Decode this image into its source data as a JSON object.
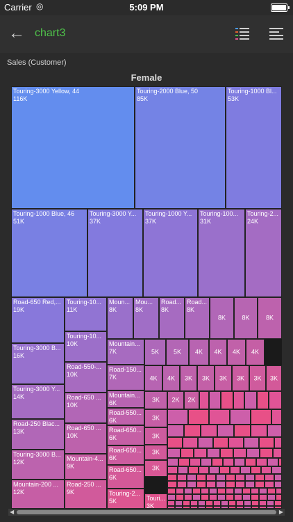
{
  "status": {
    "carrier": "Carrier",
    "time": "5:09 PM"
  },
  "nav": {
    "title": "chart3"
  },
  "header": {
    "subtitle": "Sales (Customer)"
  },
  "colors": {
    "accent": "#4fc24a",
    "blue": "#4b9bfa",
    "pink": "#e0548e"
  },
  "chart_data": {
    "type": "treemap",
    "title": "Female",
    "subtitle": "Sales (Customer)",
    "cells": [
      {
        "name": "Touring-3000 Yellow, 44",
        "value": "116K"
      },
      {
        "name": "Touring-2000 Blue, 50",
        "value": "85K"
      },
      {
        "name": "Touring-1000 Bl...",
        "value": "53K"
      },
      {
        "name": "Touring-1000 Blue, 46",
        "value": "51K"
      },
      {
        "name": "Touring-3000 Y...",
        "value": "37K"
      },
      {
        "name": "Touring-1000 Y...",
        "value": "37K"
      },
      {
        "name": "Touring-100...",
        "value": "31K"
      },
      {
        "name": "Touring-2...",
        "value": "24K"
      },
      {
        "name": "Road-650 Red,...",
        "value": "19K"
      },
      {
        "name": "Touring-10...",
        "value": "11K"
      },
      {
        "name": "Moun...",
        "value": "8K"
      },
      {
        "name": "Mou...",
        "value": "8K"
      },
      {
        "name": "Road...",
        "value": "8K"
      },
      {
        "name": "Road...",
        "value": "8K"
      },
      {
        "name": "",
        "value": "8K"
      },
      {
        "name": "",
        "value": "8K"
      },
      {
        "name": "",
        "value": "8K"
      },
      {
        "name": "Touring-3000 B...",
        "value": "16K"
      },
      {
        "name": "Touring-10...",
        "value": "10K"
      },
      {
        "name": "Mountain...",
        "value": "7K"
      },
      {
        "name": "",
        "value": "5K"
      },
      {
        "name": "",
        "value": "5K"
      },
      {
        "name": "",
        "value": "4K"
      },
      {
        "name": "",
        "value": "4K"
      },
      {
        "name": "",
        "value": "4K"
      },
      {
        "name": "",
        "value": "4K"
      },
      {
        "name": "Road-550-...",
        "value": "10K"
      },
      {
        "name": "Road-150...",
        "value": "7K"
      },
      {
        "name": "",
        "value": "4K"
      },
      {
        "name": "",
        "value": "4K"
      },
      {
        "name": "",
        "value": "3K"
      },
      {
        "name": "",
        "value": "3K"
      },
      {
        "name": "",
        "value": "3K"
      },
      {
        "name": "",
        "value": "3K"
      },
      {
        "name": "",
        "value": "3K"
      },
      {
        "name": "",
        "value": "3K"
      },
      {
        "name": "Touring-3000 Y...",
        "value": "14K"
      },
      {
        "name": "Road-650 ...",
        "value": "10K"
      },
      {
        "name": "Mountain...",
        "value": "6K"
      },
      {
        "name": "",
        "value": "3K"
      },
      {
        "name": "",
        "value": "2K"
      },
      {
        "name": "",
        "value": "2K"
      },
      {
        "name": "Road-550...",
        "value": "6K"
      },
      {
        "name": "",
        "value": "3K"
      },
      {
        "name": "Road-250 Blac...",
        "value": "13K"
      },
      {
        "name": "Road-650 ...",
        "value": "10K"
      },
      {
        "name": "Road-650...",
        "value": "6K"
      },
      {
        "name": "",
        "value": "3K"
      },
      {
        "name": "Road-650...",
        "value": "6K"
      },
      {
        "name": "",
        "value": "3K"
      },
      {
        "name": "Touring-3000 B...",
        "value": "12K"
      },
      {
        "name": "Mountain-4...",
        "value": "9K"
      },
      {
        "name": "Road-650...",
        "value": "6K"
      },
      {
        "name": "",
        "value": "3K"
      },
      {
        "name": "Mountain-200 ...",
        "value": "12K"
      },
      {
        "name": "Road-250 ...",
        "value": "9K"
      },
      {
        "name": "Touring-2...",
        "value": "5K"
      },
      {
        "name": "Touri...",
        "value": "3K"
      }
    ]
  }
}
